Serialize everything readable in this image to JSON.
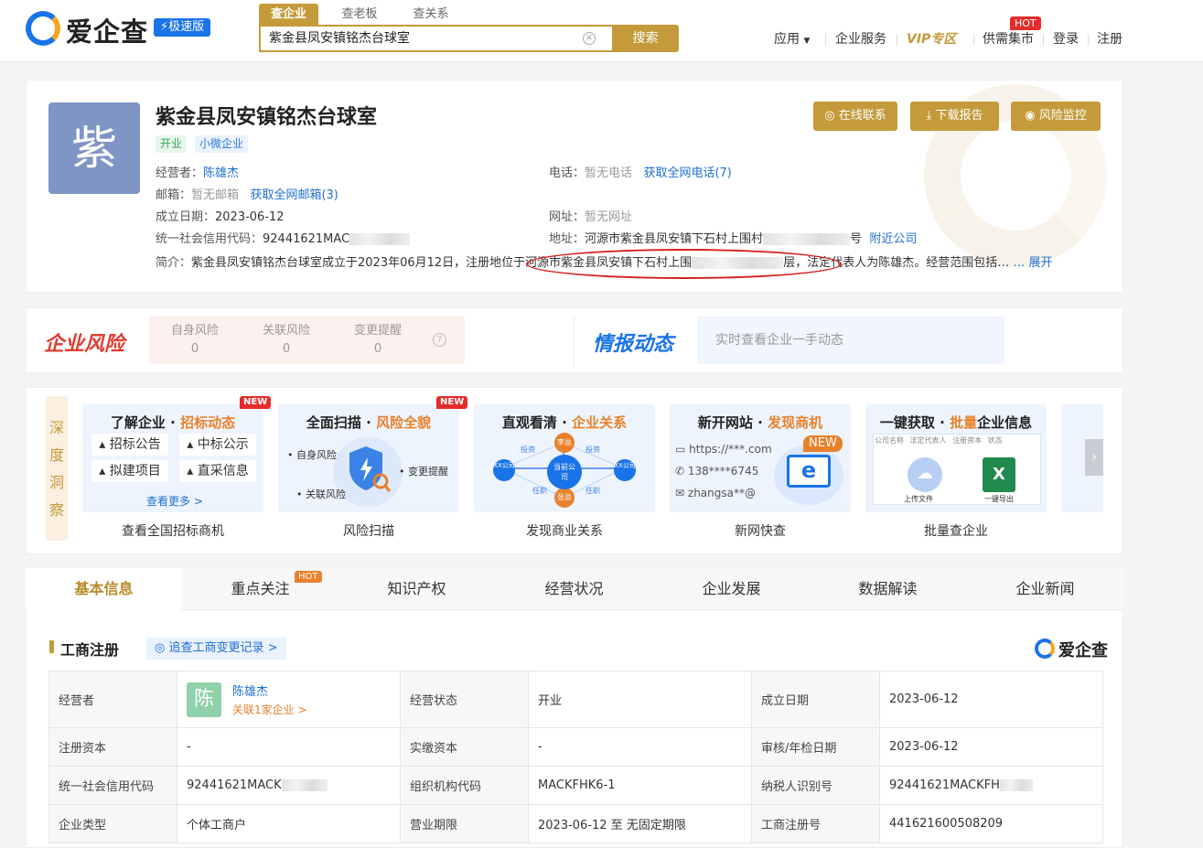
{
  "header": {
    "logo": "爱企查",
    "badge": "⚡极速版",
    "search_tabs": [
      "查企业",
      "查老板",
      "查关系"
    ],
    "search_value": "紫金县凤安镇铭杰台球室",
    "search_button": "搜索",
    "nav": [
      "应用",
      "企业服务",
      "VIP专区",
      "供需集市",
      "登录",
      "注册"
    ],
    "hot": "HOT"
  },
  "company": {
    "avatar": "紫",
    "name": "紫金县凤安镇铭杰台球室",
    "tags": [
      "开业",
      "小微企业"
    ],
    "operator_label": "经营者：",
    "operator": "陈雄杰",
    "phone_label": "电话：",
    "phone": "暂无电话",
    "phone_link": "获取全网电话(7)",
    "email_label": "邮箱：",
    "email": "暂无邮箱",
    "email_link": "获取全网邮箱(3)",
    "date_label": "成立日期：",
    "date": "2023-06-12",
    "site_label": "网址：",
    "site": "暂无网址",
    "credit_label": "统一社会信用代码：",
    "credit": "92441621MAC",
    "addr_label": "地址：",
    "addr": "河源市紫金县凤安镇下石村上围村",
    "addr_suffix": "号",
    "nearby": "附近公司",
    "intro_label": "简介：",
    "intro_a": "紫金县凤安镇铭杰台球室成立于2023年06月12日，注册地位于河源市紫金县凤安镇下石村上围",
    "intro_b": "层，法定代表人为陈雄杰。经营范围包括…",
    "expand": "… 展开",
    "actions": [
      "在线联系",
      "下载报告",
      "风险监控"
    ]
  },
  "risk": {
    "title": "企业风险",
    "items": [
      {
        "label": "自身风险",
        "value": "0"
      },
      {
        "label": "关联风险",
        "value": "0"
      },
      {
        "label": "变更提醒",
        "value": "0"
      }
    ],
    "intel_title": "情报动态",
    "intel_placeholder": "实时查看企业一手动态"
  },
  "insight": {
    "side": [
      "深",
      "度",
      "洞",
      "察"
    ],
    "new": "NEW",
    "c1": {
      "t1": "了解企业 · ",
      "t2": "招标动态",
      "pills": [
        "招标公告",
        "中标公示",
        "拟建项目",
        "直采信息"
      ],
      "more": "查看更多 >",
      "cap": "查看全国招标商机"
    },
    "c2": {
      "t1": "全面扫描 · ",
      "t2": "风险全貌",
      "labels": [
        "自身风险",
        "变更提醒",
        "关联风险"
      ],
      "cap": "风险扫描"
    },
    "c3": {
      "t1": "直观看清 · ",
      "t2": "企业关系",
      "nodes": [
        "李总",
        "张总",
        "当前公司",
        "XX公司",
        "XX公司"
      ],
      "edges": [
        "投资",
        "投资",
        "任职",
        "任职"
      ],
      "cap": "发现商业关系"
    },
    "c4": {
      "t1": "新开网站 · ",
      "t2": "发现商机",
      "lines": [
        "https://***.com",
        "138****6745",
        "zhangsa**@"
      ],
      "new": "NEW",
      "cap": "新网快查"
    },
    "c5": {
      "t1": "一键获取 · ",
      "t2": "批量",
      "t3": "企业信息",
      "cols": [
        "公司名称",
        "法定代表人",
        "注册资本",
        "状态"
      ],
      "up": "上传文件",
      "ex": "一键导出",
      "cap": "批量查企业"
    }
  },
  "tabs": [
    "基本信息",
    "重点关注",
    "知识产权",
    "经营状况",
    "企业发展",
    "数据解读",
    "企业新闻"
  ],
  "tab_hot": "HOT",
  "section": {
    "title": "工商注册",
    "trace": "追查工商变更记录 >",
    "brand": "爱企查",
    "rows": [
      [
        "经营者",
        "",
        "经营状态",
        "开业",
        "成立日期",
        "2023-06-12"
      ],
      [
        "注册资本",
        "-",
        "实缴资本",
        "-",
        "审核/年检日期",
        "2023-06-12"
      ],
      [
        "统一社会信用代码",
        "92441621MACK",
        "组织机构代码",
        "MACKFHK6-1",
        "纳税人识别号",
        "92441621MACKFH"
      ],
      [
        "企业类型",
        "个体工商户",
        "营业期限",
        "2023-06-12 至 无固定期限",
        "工商注册号",
        "441621600508209"
      ]
    ],
    "operator_avatar": "陈",
    "operator_name": "陈雄杰",
    "operator_link": "关联1家企业 >"
  }
}
